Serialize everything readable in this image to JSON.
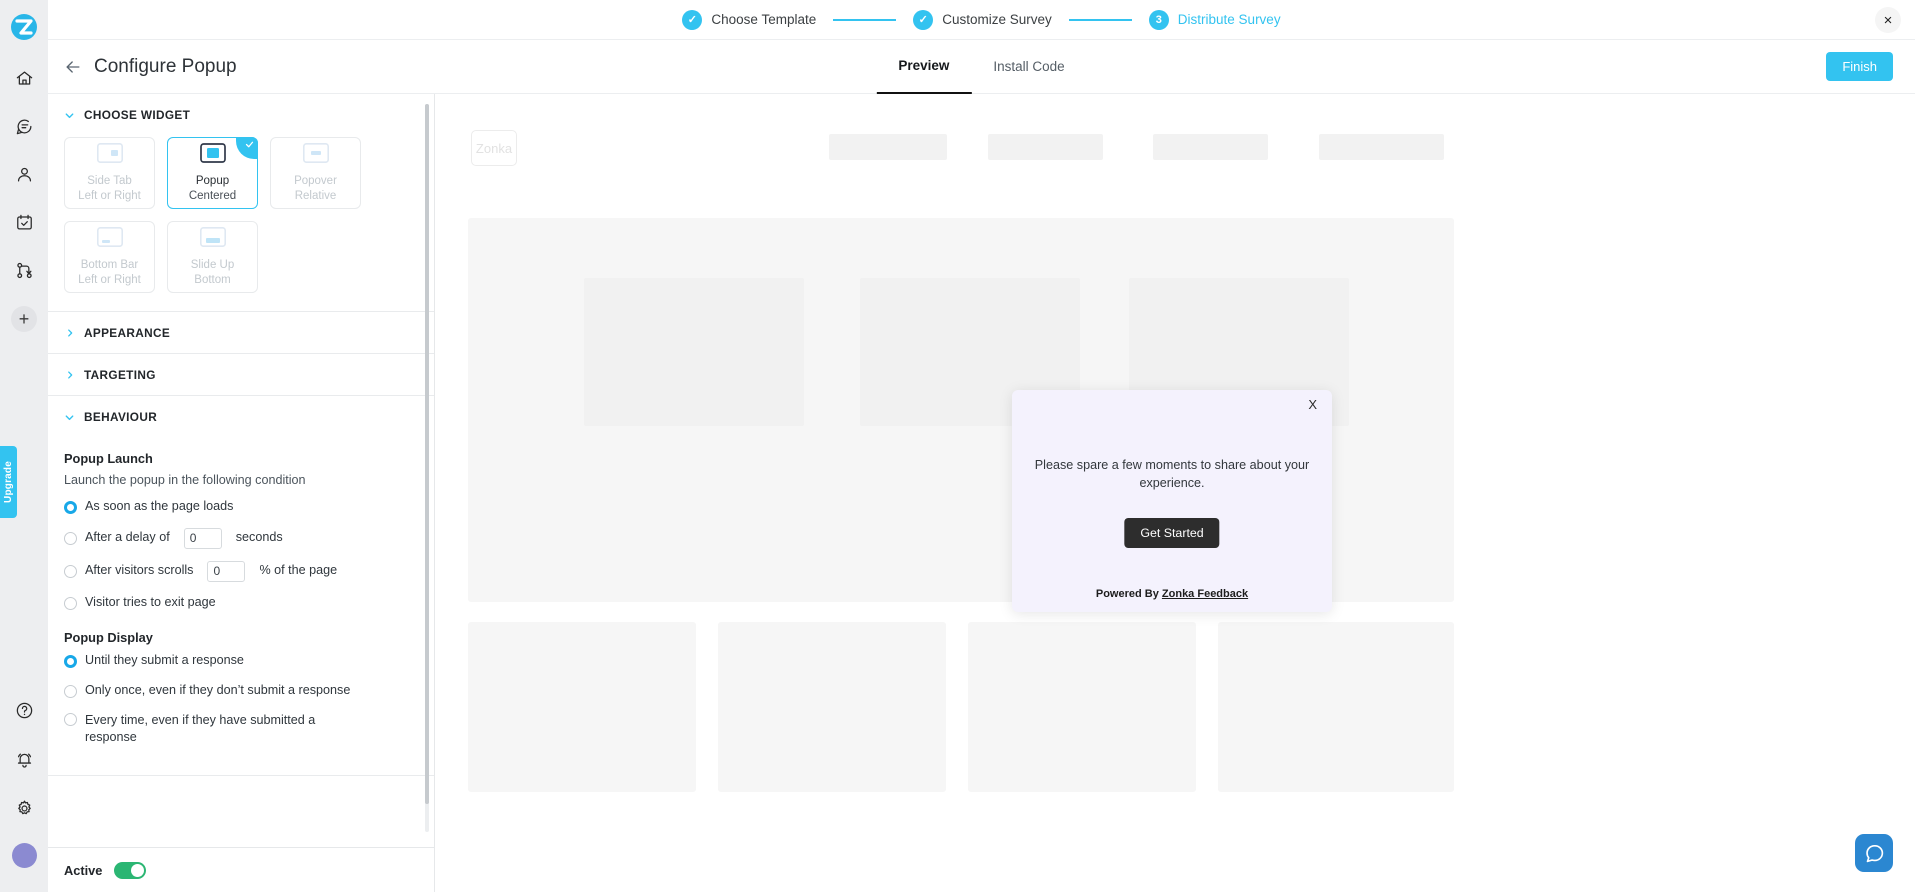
{
  "rail": {
    "logo": "zonka-logo-icon",
    "items": [
      {
        "name": "home-icon"
      },
      {
        "name": "feedback-icon"
      },
      {
        "name": "contacts-icon"
      },
      {
        "name": "tasks-icon"
      },
      {
        "name": "workflow-icon"
      }
    ],
    "add_label": "+",
    "upgrade_label": "Upgrade",
    "bottom": [
      {
        "name": "help-icon"
      },
      {
        "name": "notifications-icon"
      },
      {
        "name": "settings-icon"
      }
    ]
  },
  "topbar": {
    "steps": [
      {
        "badge": "✓",
        "label": "Choose Template",
        "state": "done"
      },
      {
        "badge": "✓",
        "label": "Customize Survey",
        "state": "done"
      },
      {
        "badge": "3",
        "label": "Distribute Survey",
        "state": "active"
      }
    ],
    "close_label": "×"
  },
  "header": {
    "title": "Configure Popup",
    "tabs": [
      {
        "label": "Preview",
        "selected": true
      },
      {
        "label": "Install Code",
        "selected": false
      }
    ],
    "finish_label": "Finish"
  },
  "panel": {
    "sections": [
      {
        "title": "CHOOSE WIDGET",
        "expanded": true
      },
      {
        "title": "APPEARANCE",
        "expanded": false
      },
      {
        "title": "TARGETING",
        "expanded": false
      },
      {
        "title": "BEHAVIOUR",
        "expanded": true
      }
    ],
    "widgets": [
      {
        "name": "Side Tab",
        "sub": "Left or Right",
        "selected": false
      },
      {
        "name": "Popup",
        "sub": "Centered",
        "selected": true
      },
      {
        "name": "Popover",
        "sub": "Relative",
        "selected": false
      },
      {
        "name": "Bottom Bar",
        "sub": "Left or Right",
        "selected": false
      },
      {
        "name": "Slide Up",
        "sub": "Bottom",
        "selected": false
      }
    ],
    "popup_launch": {
      "title": "Popup Launch",
      "subtitle": "Launch the popup in the following condition",
      "options": [
        {
          "label": "As soon as the page loads",
          "selected": true
        },
        {
          "label_before": "After a delay of",
          "value": "0",
          "label_after": "seconds",
          "selected": false
        },
        {
          "label_before": "After visitors scrolls",
          "value": "0",
          "label_after": "% of the page",
          "selected": false
        },
        {
          "label": "Visitor tries to exit page",
          "selected": false
        }
      ]
    },
    "popup_display": {
      "title": "Popup Display",
      "options": [
        {
          "label": "Until they submit a response",
          "selected": true
        },
        {
          "label": "Only once, even if they don’t submit a response",
          "selected": false
        },
        {
          "label": "Every time, even if they have submitted a response",
          "selected": false
        }
      ]
    },
    "active": {
      "label": "Active",
      "on": true
    }
  },
  "preview": {
    "site_logo_text": "Zonka",
    "popup": {
      "close_label": "X",
      "message": "Please spare a few moments to share about your experience.",
      "cta_label": "Get Started",
      "footer_prefix": "Powered By ",
      "footer_link": "Zonka Feedback"
    },
    "chat_icon": "chat-bubble-icon"
  },
  "colors": {
    "accent": "#33c3f0",
    "toggle_on": "#2bb673",
    "popup_bg": "#f4f2fd",
    "cta_bg": "#2d2d2d"
  }
}
